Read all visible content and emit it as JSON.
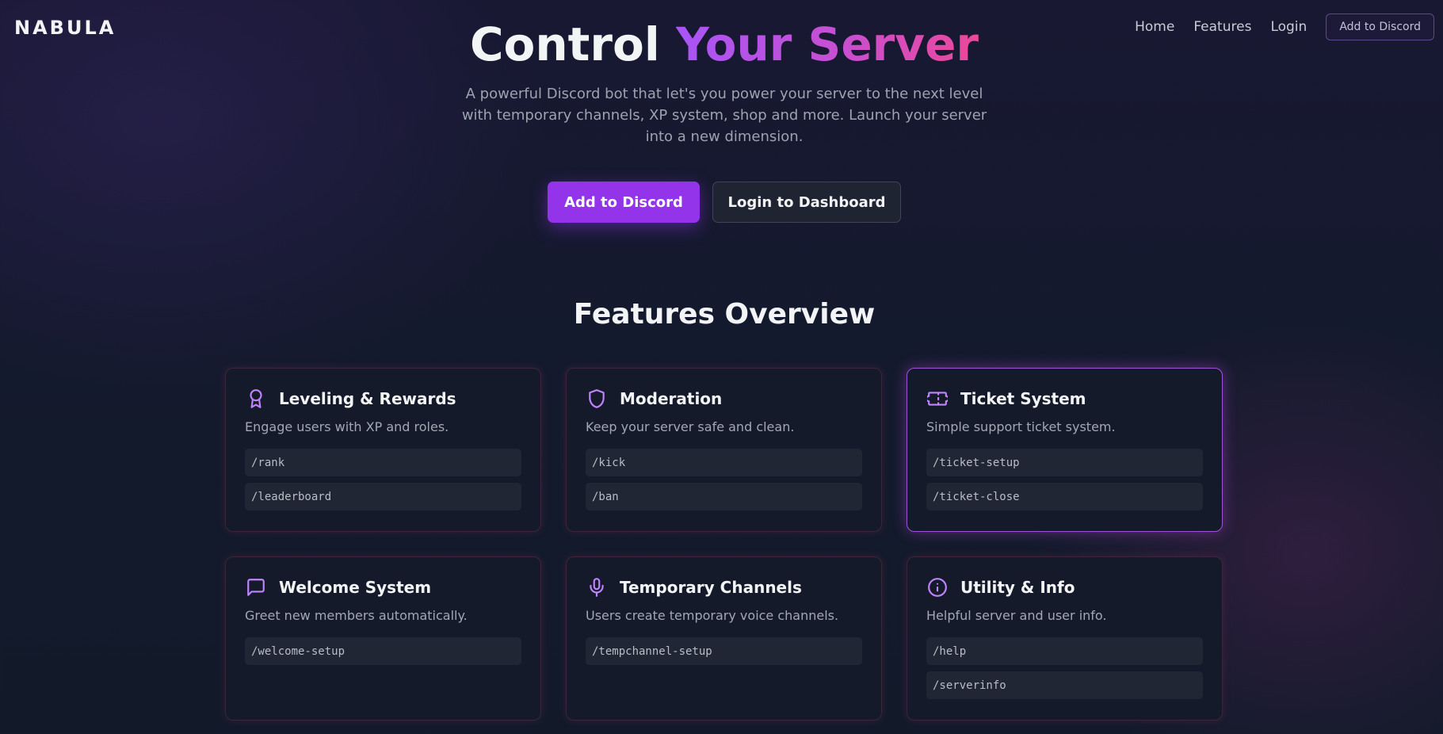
{
  "brand": {
    "logo": "NABULA",
    "accent_color": "#9333ea",
    "gradient_start": "#a855f7",
    "gradient_end": "#ec4899"
  },
  "nav": {
    "links": [
      "Home",
      "Features",
      "Login"
    ],
    "cta": "Add to Discord"
  },
  "hero": {
    "title_plain": "Control",
    "title_accent": "Your Server",
    "subtitle": "A powerful Discord bot that let's you power your server to the next level with temporary channels, XP system, shop and more. Launch your server into a new dimension.",
    "primary_button": "Add to Discord",
    "secondary_button": "Login to Dashboard"
  },
  "features": {
    "title": "Features Overview",
    "cards": [
      {
        "icon": "award-icon",
        "title": "Leveling & Rewards",
        "desc": "Engage users with XP and roles.",
        "commands": [
          "/rank",
          "/leaderboard"
        ]
      },
      {
        "icon": "shield-icon",
        "title": "Moderation",
        "desc": "Keep your server safe and clean.",
        "commands": [
          "/kick",
          "/ban"
        ]
      },
      {
        "icon": "ticket-icon",
        "title": "Ticket System",
        "desc": "Simple support ticket system.",
        "commands": [
          "/ticket-setup",
          "/ticket-close"
        ]
      },
      {
        "icon": "chat-bubble-icon",
        "title": "Welcome System",
        "desc": "Greet new members automatically.",
        "commands": [
          "/welcome-setup"
        ]
      },
      {
        "icon": "microphone-icon",
        "title": "Temporary Channels",
        "desc": "Users create temporary voice channels.",
        "commands": [
          "/tempchannel-setup"
        ]
      },
      {
        "icon": "info-icon",
        "title": "Utility & Info",
        "desc": "Helpful server and user info.",
        "commands": [
          "/help",
          "/serverinfo"
        ]
      }
    ]
  }
}
